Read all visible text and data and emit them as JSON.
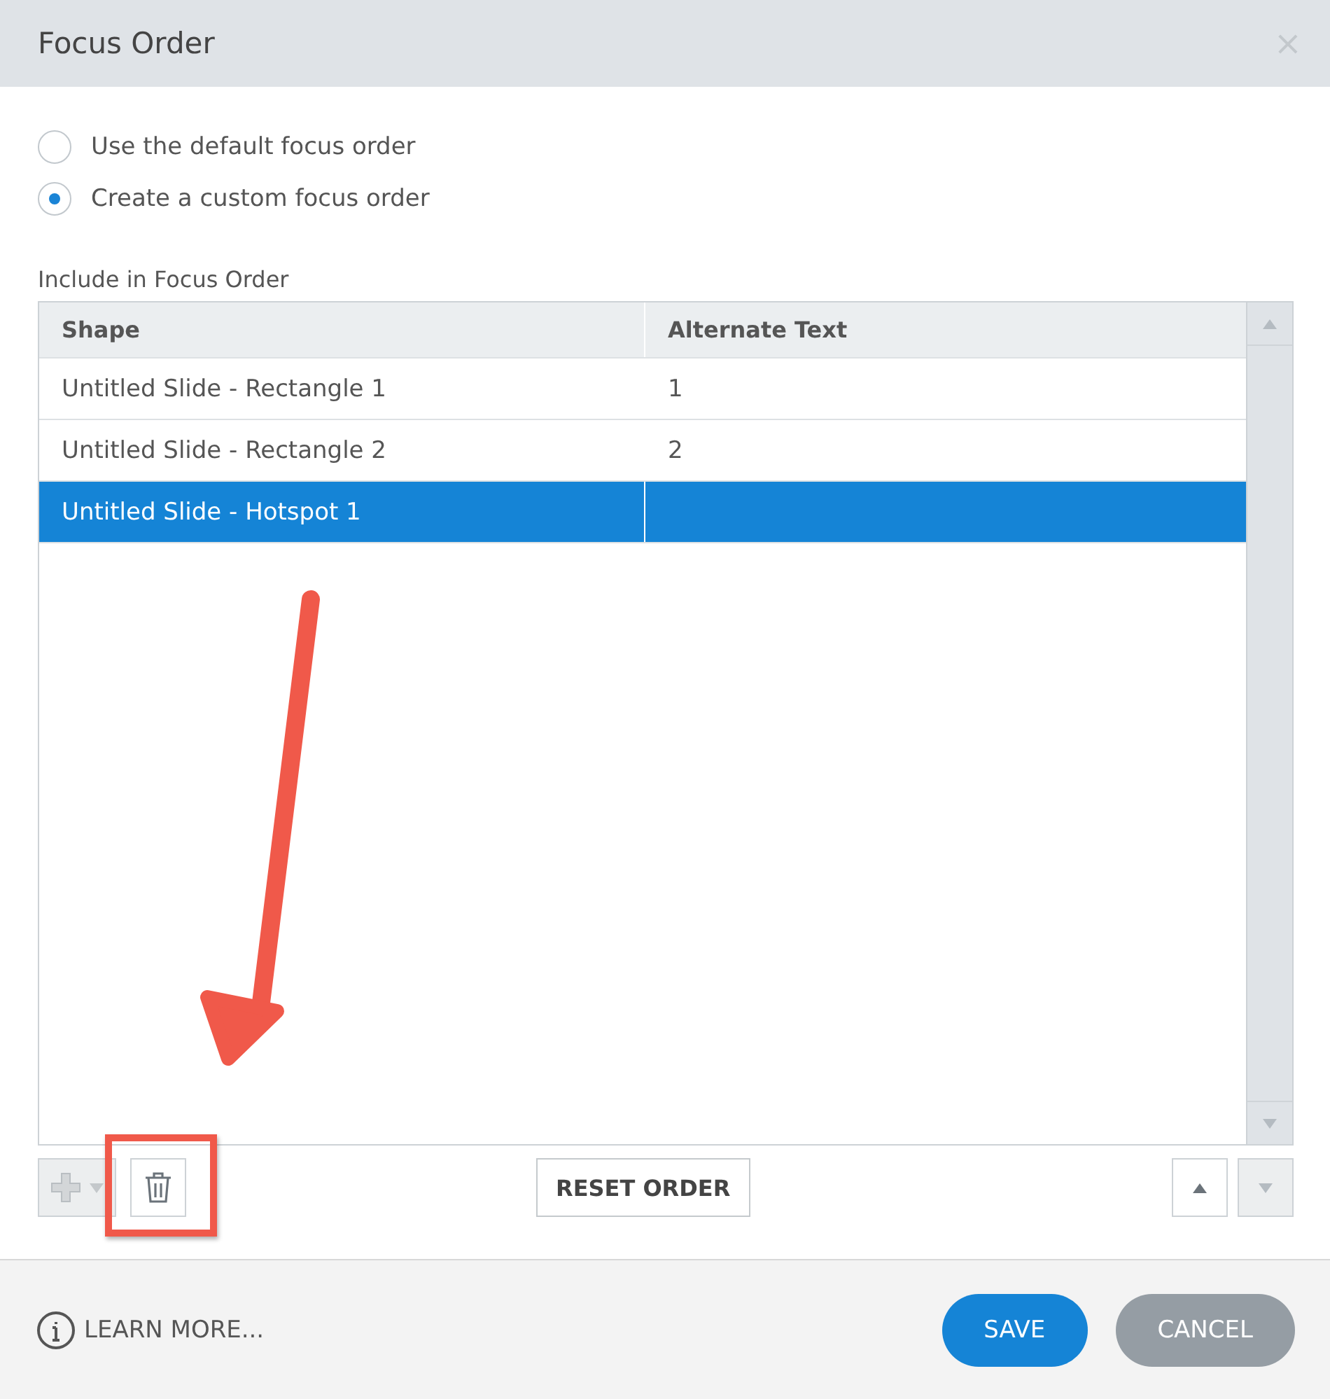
{
  "window": {
    "title": "Focus Order",
    "close": "×"
  },
  "options": [
    {
      "label": "Use the default focus order",
      "selected": false
    },
    {
      "label": "Create a custom focus order",
      "selected": true
    }
  ],
  "table": {
    "caption": "Include in Focus Order",
    "columns": [
      "Shape",
      "Alternate Text"
    ],
    "rows": [
      {
        "cells": [
          "Untitled Slide - Rectangle 1",
          "1"
        ],
        "selected": false
      },
      {
        "cells": [
          "Untitled Slide - Rectangle 2",
          "2"
        ],
        "selected": false
      },
      {
        "cells": [
          "Untitled Slide - Hotspot 1",
          ""
        ],
        "selected": true
      }
    ]
  },
  "toolbar": {
    "add_disabled": true,
    "reset": "RESET ORDER",
    "move_up_disabled": false,
    "move_down_disabled": true
  },
  "footer": {
    "learn_more": "LEARN MORE...",
    "save": "SAVE",
    "cancel": "CANCEL"
  },
  "annotation": {
    "kind": "arrow-and-frame"
  }
}
